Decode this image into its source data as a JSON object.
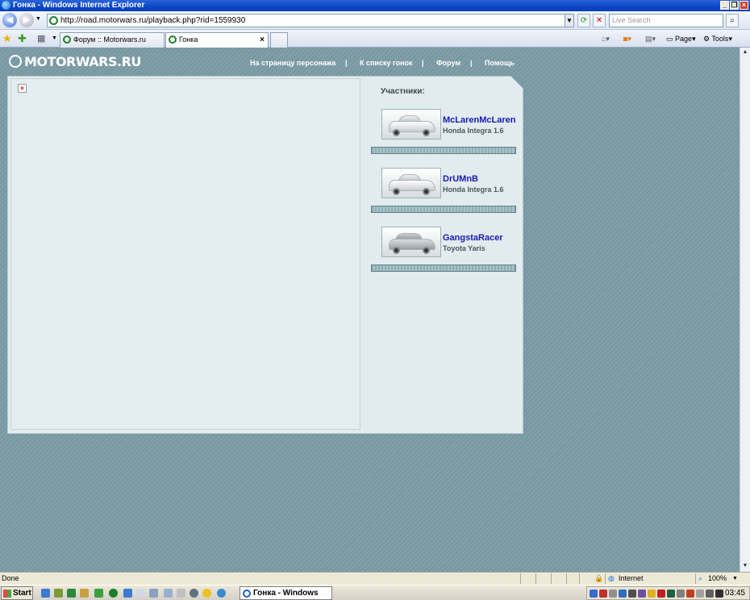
{
  "browser": {
    "window_title": "Гонка - Windows Internet Explorer",
    "url": "http://road.motorwars.ru/playback.php?rid=1559930",
    "search_placeholder": "Live Search",
    "tabs": [
      {
        "label": "Форум :: Motorwars.ru",
        "active": false
      },
      {
        "label": "Гонка",
        "active": true
      }
    ],
    "toolbar": {
      "page_label": "Page",
      "tools_label": "Tools"
    },
    "status_text": "Done",
    "zone_label": "Internet",
    "zoom": "100%"
  },
  "site": {
    "logo": "MOTORWARS.RU",
    "nav": [
      "На страницу персонажа",
      "К списку гонок",
      "Форум",
      "Помощь"
    ],
    "participants_title": "Участники:",
    "racers": [
      {
        "name": "McLarenMcLaren",
        "car": "Honda Integra 1.6"
      },
      {
        "name": "DrUMnB",
        "car": "Honda Integra 1.6"
      },
      {
        "name": "GangstaRacer",
        "car": "Toyota Yaris"
      }
    ],
    "background_color": "#7b9ca6",
    "name_color": "#1a1ab0"
  },
  "taskbar": {
    "start_label": "Start",
    "task_label": "Гонка - Windows Inte...",
    "clock": "03:45"
  }
}
